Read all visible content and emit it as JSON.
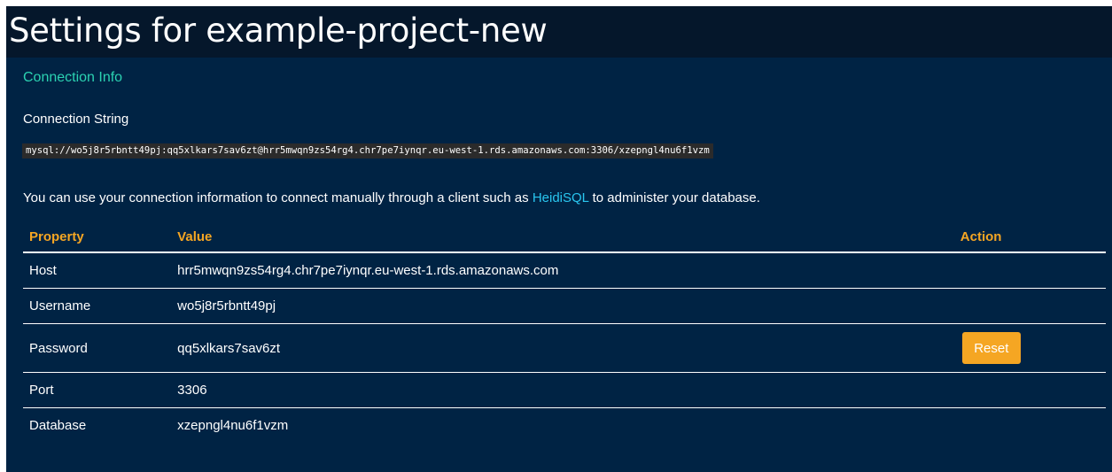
{
  "header": {
    "title": "Settings for example-project-new"
  },
  "connection_info": {
    "heading": "Connection Info",
    "string_label": "Connection String",
    "connection_string": "mysql://wo5j8r5rbntt49pj:qq5xlkars7sav6zt@hrr5mwqn9zs54rg4.chr7pe7iynqr.eu-west-1.rds.amazonaws.com:3306/xzepngl4nu6f1vzm",
    "help_prefix": "You can use your connection information to connect manually through a client such as ",
    "help_link": "HeidiSQL",
    "help_suffix": " to administer your database."
  },
  "table": {
    "headers": {
      "property": "Property",
      "value": "Value",
      "action": "Action"
    },
    "rows": [
      {
        "property": "Host",
        "value": "hrr5mwqn9zs54rg4.chr7pe7iynqr.eu-west-1.rds.amazonaws.com"
      },
      {
        "property": "Username",
        "value": "wo5j8r5rbntt49pj"
      },
      {
        "property": "Password",
        "value": "qq5xlkars7sav6zt",
        "action": "Reset"
      },
      {
        "property": "Port",
        "value": "3306"
      },
      {
        "property": "Database",
        "value": "xzepngl4nu6f1vzm"
      }
    ]
  },
  "colors": {
    "header_bg": "#05172b",
    "panel_bg": "#002344",
    "accent_teal": "#2bd2b2",
    "accent_orange": "#f5a623",
    "link": "#29c6f0"
  }
}
